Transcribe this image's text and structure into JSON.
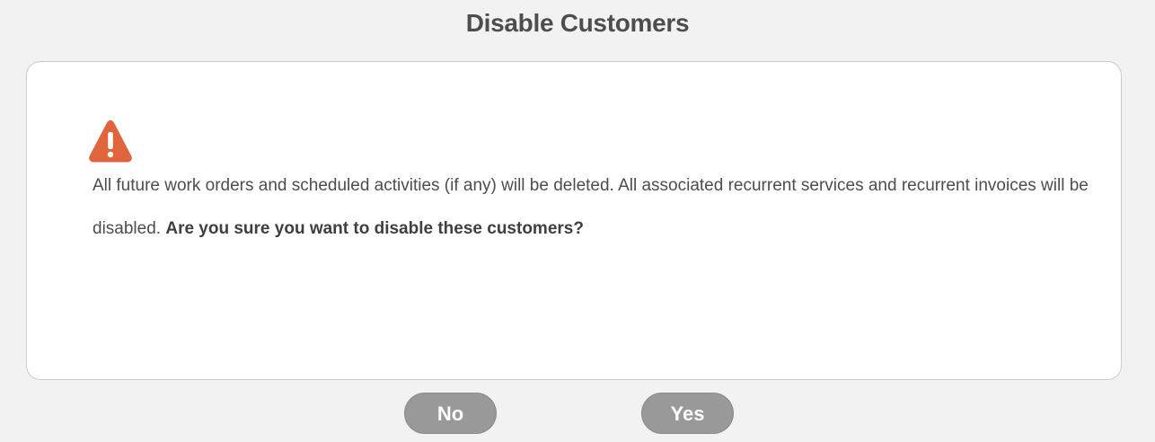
{
  "dialog": {
    "title": "Disable Customers",
    "icon": "warning-triangle-icon",
    "icon_color": "#e0643c",
    "message_text": "All future work orders and scheduled activities (if any) will be deleted. All associated recurrent services and recurrent invoices will be disabled.",
    "message_question": "Are you sure you want to disable these customers?"
  },
  "buttons": {
    "no_label": "No",
    "yes_label": "Yes"
  }
}
